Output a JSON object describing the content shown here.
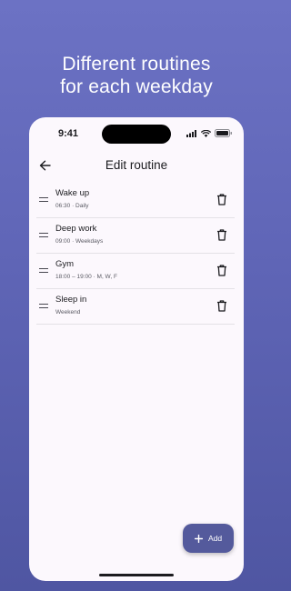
{
  "promo": {
    "title": "Different routines\nfor each weekday"
  },
  "status_bar": {
    "time": "9:41",
    "icons": [
      "cellular-signal-icon",
      "wifi-icon",
      "battery-icon"
    ]
  },
  "app_bar": {
    "back_icon": "arrow-back-icon",
    "title": "Edit routine"
  },
  "routines": [
    {
      "title": "Wake up",
      "subtitle": "06:30 · Daily"
    },
    {
      "title": "Deep work",
      "subtitle": "09:00 · Weekdays"
    },
    {
      "title": "Gym",
      "subtitle": "18:00 – 19:00 · M, W, F"
    },
    {
      "title": "Sleep in",
      "subtitle": "Weekend"
    }
  ],
  "fab": {
    "icon": "plus-icon",
    "label": "Add"
  },
  "colors": {
    "background_top": "#6c72c4",
    "background_bottom": "#4f56a2",
    "surface": "#fcf8fd",
    "fab": "#545a9c",
    "text": "#1b1b1f"
  }
}
